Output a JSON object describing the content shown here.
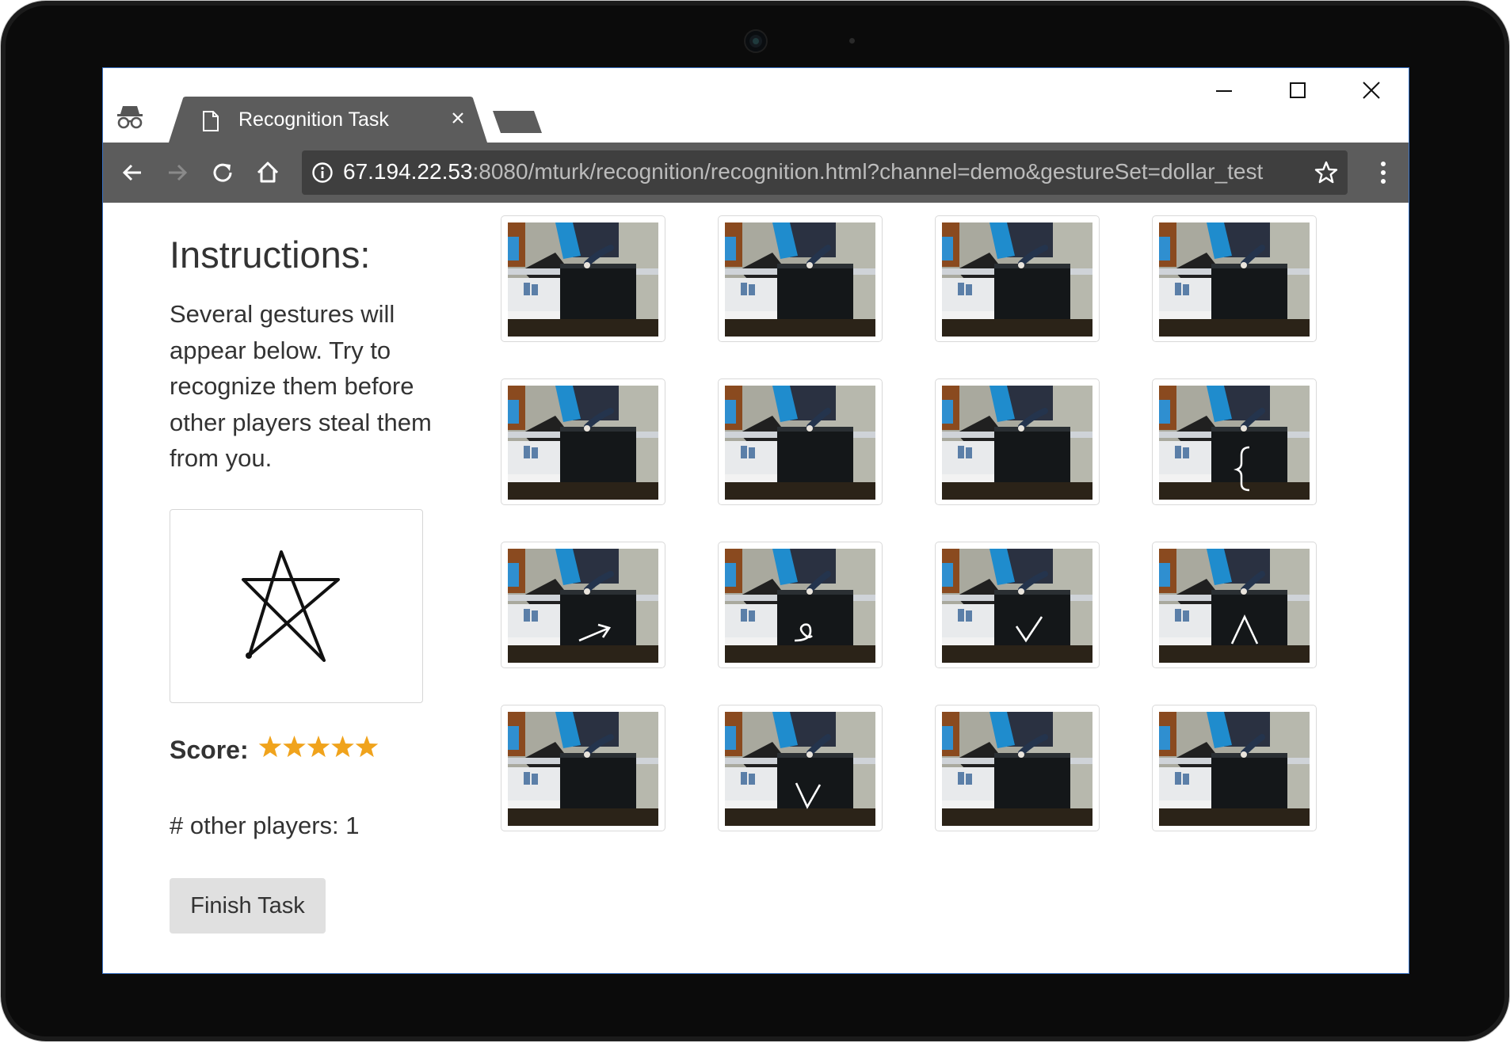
{
  "browser": {
    "tab_title": "Recognition Task",
    "url_host": "67.194.22.53",
    "url_rest": ":8080/mturk/recognition/recognition.html?channel=demo&gestureSet=dollar_test"
  },
  "page": {
    "instructions_title": "Instructions:",
    "instructions_text": "Several gestures will appear below. Try to recognize them before other players steal them from you.",
    "score_label": "Score:",
    "score_stars": 5,
    "players_text": "# other players: 1",
    "finish_label": "Finish Task",
    "target_gesture": "star-icon"
  },
  "gesture_thumbnails": [
    {
      "gesture": "none"
    },
    {
      "gesture": "none"
    },
    {
      "gesture": "none"
    },
    {
      "gesture": "none"
    },
    {
      "gesture": "none"
    },
    {
      "gesture": "none"
    },
    {
      "gesture": "none"
    },
    {
      "gesture": "left-curly-brace"
    },
    {
      "gesture": "arrow"
    },
    {
      "gesture": "pigtail"
    },
    {
      "gesture": "check"
    },
    {
      "gesture": "caret"
    },
    {
      "gesture": "none"
    },
    {
      "gesture": "v"
    },
    {
      "gesture": "none"
    },
    {
      "gesture": "none"
    }
  ],
  "colors": {
    "toolbar": "#5c5c5c",
    "tab_active": "#5c5c5c",
    "star_rating": "#f0a31c",
    "button_bg": "#e0e0e0"
  }
}
